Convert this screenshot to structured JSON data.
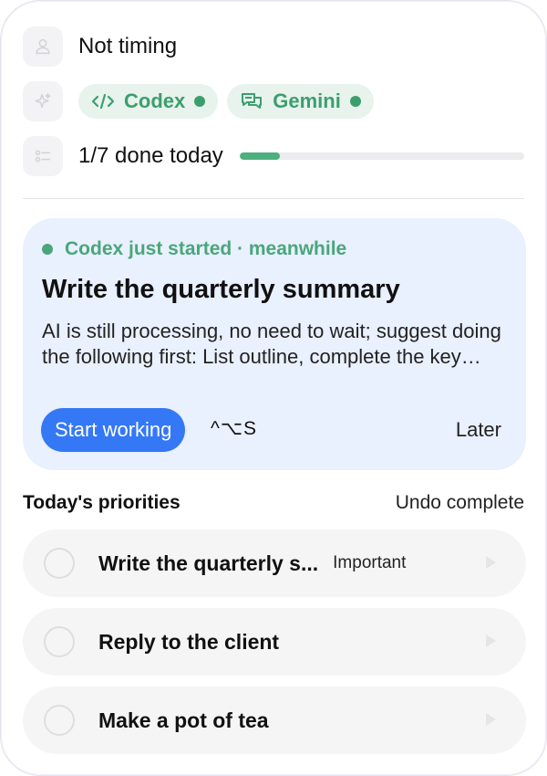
{
  "status": {
    "timer_text": "Not timing"
  },
  "agents": [
    {
      "name": "Codex",
      "status_color": "#3c9e6e"
    },
    {
      "name": "Gemini",
      "status_color": "#3c9e6e"
    }
  ],
  "progress": {
    "text": "1/7 done today",
    "done": 1,
    "total": 7,
    "fraction": 0.143
  },
  "suggestion": {
    "eyebrow": "Codex just started · meanwhile",
    "title": "Write the quarterly summary",
    "description": "AI is still processing, no need to wait; suggest doing the following first: List outline, complete the key sections and review figures",
    "primary_label": "Start working",
    "shortcut": "^⌥S",
    "later_label": "Later"
  },
  "priorities": {
    "title": "Today's priorities",
    "undo_label": "Undo complete",
    "items": [
      {
        "title": "Write the quarterly s...",
        "tag": "Important"
      },
      {
        "title": "Reply to the client",
        "tag": ""
      },
      {
        "title": "Make a pot of tea",
        "tag": ""
      }
    ]
  },
  "colors": {
    "accent_blue": "#3478f6",
    "accent_green": "#4caf7c",
    "card_bg": "#e9f0fe"
  }
}
